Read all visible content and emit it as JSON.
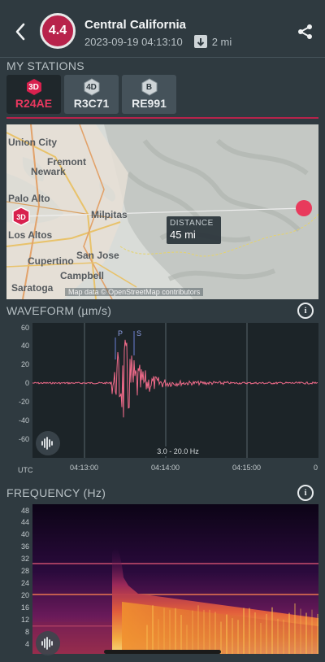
{
  "header": {
    "magnitude": "4.4",
    "title": "Central California",
    "datetime": "2023-09-19 04:13:10",
    "distance": "2 mi"
  },
  "stations": {
    "section_label": "MY STATIONS",
    "items": [
      {
        "badge": "3D",
        "code": "R24AE",
        "active": true,
        "badge_color": "#d8214e"
      },
      {
        "badge": "4D",
        "code": "R3C71",
        "active": false,
        "badge_color": "#cfd5d8"
      },
      {
        "badge": "B",
        "code": "RE991",
        "active": false,
        "badge_color": "#cfd5d8"
      }
    ]
  },
  "map": {
    "places": [
      "Union City",
      "Fremont",
      "Newark",
      "Palo Alto",
      "Milpitas",
      "Los Altos",
      "San Jose",
      "Cupertino",
      "Campbell",
      "Saratoga"
    ],
    "station_badge": "3D",
    "distance_label": "DISTANCE",
    "distance_value": "45 mi",
    "credit": "Map data © OpenStreetMap contributors"
  },
  "waveform": {
    "section_label": "WAVEFORM (µm/s)",
    "y_ticks": [
      "60",
      "40",
      "20",
      "0",
      "-20",
      "-40",
      "-60"
    ],
    "x_ticks": [
      "UTC",
      "04:13:00",
      "04:14:00",
      "04:15:00",
      "0"
    ],
    "phase_p": "P",
    "phase_s": "S",
    "filter": "3.0 - 20.0 Hz",
    "colors": {
      "trace": "#f06b8a",
      "bg": "#1c2428",
      "grid": "#59666c"
    }
  },
  "frequency": {
    "section_label": "FREQUENCY (Hz)",
    "y_ticks": [
      "48",
      "44",
      "40",
      "36",
      "32",
      "28",
      "24",
      "20",
      "16",
      "12",
      "8",
      "4"
    ]
  }
}
